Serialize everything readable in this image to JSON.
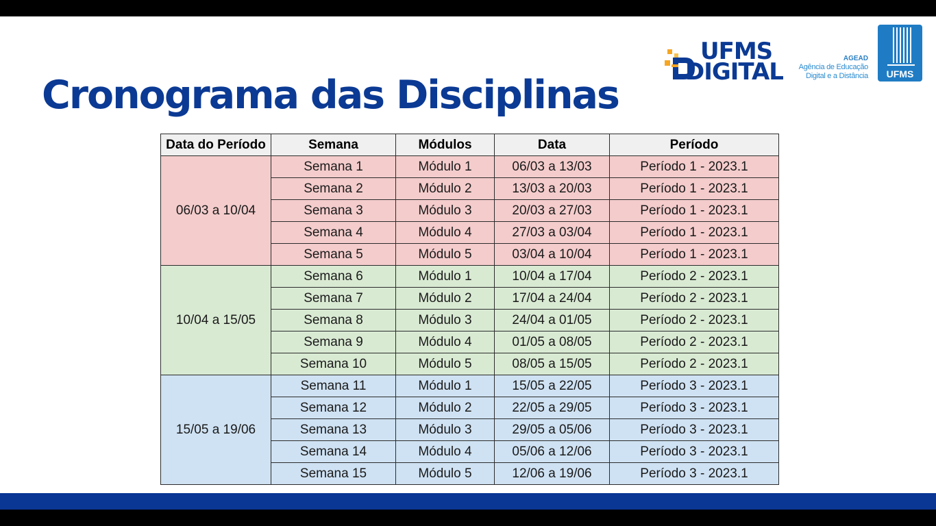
{
  "page": {
    "title": "Cronograma das Disciplinas"
  },
  "logos": {
    "ufms_digital": {
      "line1": "UFMS",
      "line2": "DIGITAL"
    },
    "agead": {
      "acronym": "AGEAD",
      "line1": "Agência de Educação",
      "line2": "Digital e a Distância"
    },
    "ufms": {
      "text": "UFMS"
    }
  },
  "colors": {
    "brand_blue": "#0b3a94",
    "period1": "#f4cccc",
    "period2": "#d9ead3",
    "period3": "#cfe2f3",
    "header": "#f0f0f0"
  },
  "table": {
    "headers": [
      "Data do Período",
      "Semana",
      "Módulos",
      "Data",
      "Período"
    ],
    "groups": [
      {
        "range": "06/03 a 10/04",
        "rows": [
          [
            "Semana 1",
            "Módulo 1",
            "06/03 a 13/03",
            "Período 1 - 2023.1"
          ],
          [
            "Semana 2",
            "Módulo 2",
            "13/03 a 20/03",
            "Período 1 - 2023.1"
          ],
          [
            "Semana 3",
            "Módulo 3",
            "20/03 a 27/03",
            "Período 1 - 2023.1"
          ],
          [
            "Semana 4",
            "Módulo 4",
            "27/03 a 03/04",
            "Período 1 - 2023.1"
          ],
          [
            "Semana 5",
            "Módulo 5",
            "03/04 a 10/04",
            "Período 1 - 2023.1"
          ]
        ]
      },
      {
        "range": "10/04 a 15/05",
        "rows": [
          [
            "Semana 6",
            "Módulo 1",
            "10/04 a 17/04",
            "Período 2 - 2023.1"
          ],
          [
            "Semana 7",
            "Módulo 2",
            "17/04 a 24/04",
            "Período 2 - 2023.1"
          ],
          [
            "Semana 8",
            "Módulo 3",
            "24/04 a 01/05",
            "Período 2 - 2023.1"
          ],
          [
            "Semana 9",
            "Módulo 4",
            "01/05 a 08/05",
            "Período 2 - 2023.1"
          ],
          [
            "Semana 10",
            "Módulo 5",
            "08/05 a 15/05",
            "Período 2 - 2023.1"
          ]
        ]
      },
      {
        "range": "15/05 a 19/06",
        "rows": [
          [
            "Semana 11",
            "Módulo 1",
            "15/05 a 22/05",
            "Período 3 - 2023.1"
          ],
          [
            "Semana 12",
            "Módulo 2",
            "22/05 a 29/05",
            "Período 3 - 2023.1"
          ],
          [
            "Semana 13",
            "Módulo 3",
            "29/05 a 05/06",
            "Período 3 - 2023.1"
          ],
          [
            "Semana 14",
            "Módulo 4",
            "05/06 a 12/06",
            "Período 3 - 2023.1"
          ],
          [
            "Semana 15",
            "Módulo 5",
            "12/06 a 19/06",
            "Período 3 - 2023.1"
          ]
        ]
      }
    ]
  }
}
